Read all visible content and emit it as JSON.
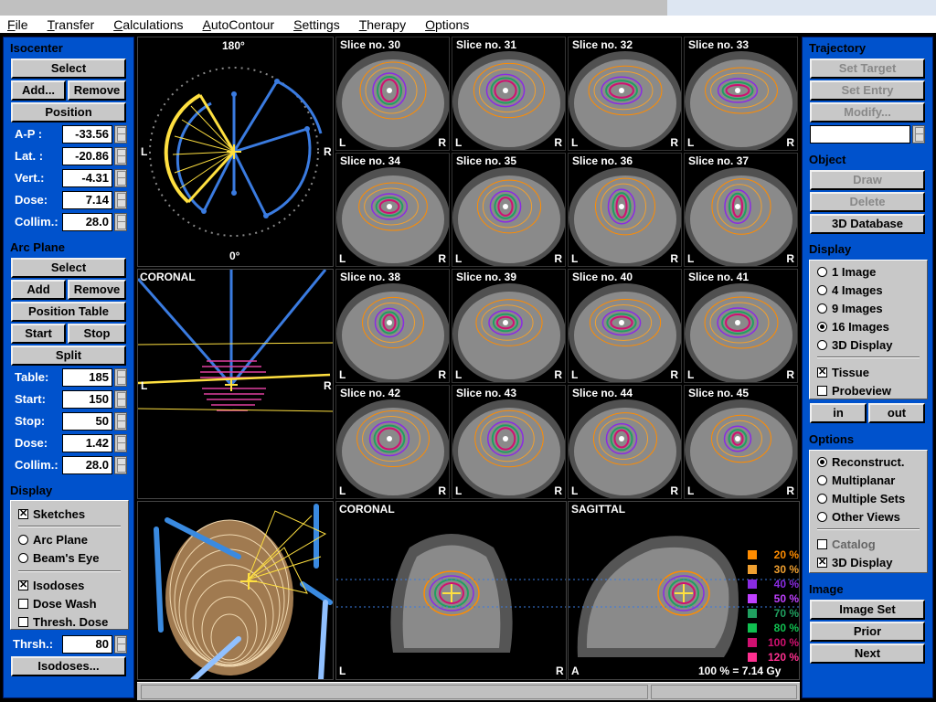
{
  "menu": [
    "File",
    "Transfer",
    "Calculations",
    "AutoContour",
    "Settings",
    "Therapy",
    "Options"
  ],
  "left": {
    "isocenter": {
      "title": "Isocenter",
      "select": "Select",
      "add": "Add...",
      "remove": "Remove",
      "position": "Position",
      "fields": [
        {
          "label": "A-P :",
          "value": "-33.56"
        },
        {
          "label": "Lat. :",
          "value": "-20.86"
        },
        {
          "label": "Vert.:",
          "value": "-4.31"
        },
        {
          "label": "Dose:",
          "value": "7.14"
        },
        {
          "label": "Collim.:",
          "value": "28.0"
        }
      ]
    },
    "arc_plane": {
      "title": "Arc Plane",
      "select": "Select",
      "add": "Add",
      "remove": "Remove",
      "position_table": "Position Table",
      "start": "Start",
      "stop": "Stop",
      "split": "Split",
      "fields": [
        {
          "label": "Table:",
          "value": "185"
        },
        {
          "label": "Start:",
          "value": "150"
        },
        {
          "label": "Stop:",
          "value": "50"
        },
        {
          "label": "Dose:",
          "value": "1.42"
        },
        {
          "label": "Collim.:",
          "value": "28.0"
        }
      ]
    },
    "display": {
      "title": "Display",
      "sketches": "Sketches",
      "arc_plane": "Arc Plane",
      "beams_eye": "Beam's Eye",
      "isodoses": "Isodoses",
      "dose_wash": "Dose Wash",
      "thresh_dose": "Thresh. Dose",
      "thresh_label": "Thrsh.:",
      "thresh_value": "80",
      "isodoses_btn": "Isodoses..."
    }
  },
  "right": {
    "trajectory": {
      "title": "Trajectory",
      "set_target": "Set Target",
      "set_entry": "Set Entry",
      "modify": "Modify..."
    },
    "object": {
      "title": "Object",
      "draw": "Draw",
      "delete": "Delete",
      "db3d": "3D Database"
    },
    "display": {
      "title": "Display",
      "opts": [
        "1 Image",
        "4 Images",
        "9 Images",
        "16 Images",
        "3D Display"
      ],
      "selected": "16 Images",
      "tissue": "Tissue",
      "probeview": "Probeview",
      "in": "in",
      "out": "out"
    },
    "options": {
      "title": "Options",
      "opts": [
        "Reconstruct.",
        "Multiplanar",
        "Multiple Sets",
        "Other Views"
      ],
      "selected": "Reconstruct.",
      "catalog": "Catalog",
      "display3d": "3D Display"
    },
    "image": {
      "title": "Image",
      "image_set": "Image Set",
      "prior": "Prior",
      "next": "Next"
    }
  },
  "views": {
    "arc_top": "180°",
    "arc_bottom": "0°",
    "L": "L",
    "R": "R",
    "coronal_small": "CORONAL",
    "coronal": "CORONAL",
    "sagittal": "SAGITTAL",
    "A": "A",
    "dose_ref": "100 % = 7.14 Gy"
  },
  "slices": [
    "Slice no. 30",
    "Slice no. 31",
    "Slice no. 32",
    "Slice no. 33",
    "Slice no. 34",
    "Slice no. 35",
    "Slice no. 36",
    "Slice no. 37",
    "Slice no. 38",
    "Slice no. 39",
    "Slice no. 40",
    "Slice no. 41",
    "Slice no. 42",
    "Slice no. 43",
    "Slice no. 44",
    "Slice no. 45"
  ],
  "legend": [
    {
      "label": "20 %",
      "color": "#ff8c00"
    },
    {
      "label": "30 %",
      "color": "#f0a030"
    },
    {
      "label": "40 %",
      "color": "#8a2be2"
    },
    {
      "label": "50 %",
      "color": "#c040ff"
    },
    {
      "label": "70 %",
      "color": "#20a060"
    },
    {
      "label": "80 %",
      "color": "#10c050"
    },
    {
      "label": "100 %",
      "color": "#d01070"
    },
    {
      "label": "120 %",
      "color": "#ff3090"
    }
  ]
}
